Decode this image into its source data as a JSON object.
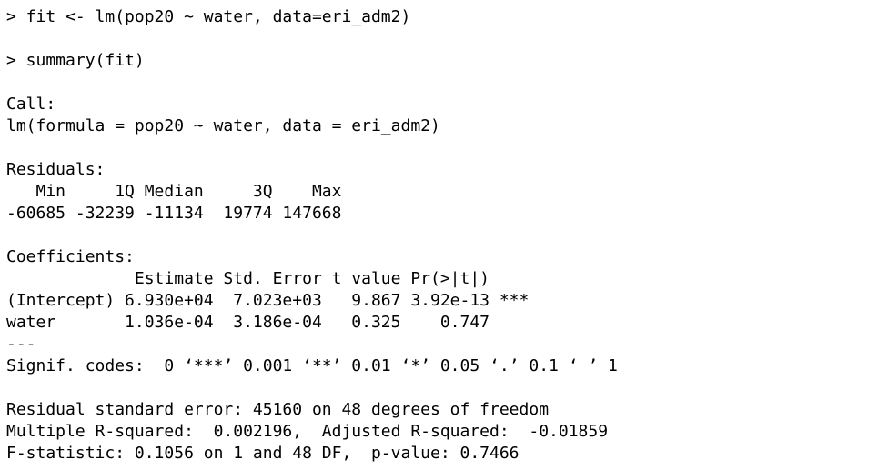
{
  "console": {
    "lines": [
      "> fit <- lm(pop20 ~ water, data=eri_adm2)",
      "",
      "> summary(fit)",
      "",
      "Call:",
      "lm(formula = pop20 ~ water, data = eri_adm2)",
      "",
      "Residuals:",
      "   Min     1Q Median     3Q    Max ",
      "-60685 -32239 -11134  19774 147668 ",
      "",
      "Coefficients:",
      "             Estimate Std. Error t value Pr(>|t|)    ",
      "(Intercept) 6.930e+04  7.023e+03   9.867 3.92e-13 ***",
      "water       1.036e-04  3.186e-04   0.325    0.747    ",
      "---",
      "Signif. codes:  0 ‘***’ 0.001 ‘**’ 0.01 ‘*’ 0.05 ‘.’ 0.1 ‘ ’ 1",
      "",
      "Residual standard error: 45160 on 48 degrees of freedom",
      "Multiple R-squared:  0.002196,\tAdjusted R-squared:  -0.01859 ",
      "F-statistic: 0.1056 on 1 and 48 DF,  p-value: 0.7466"
    ]
  }
}
